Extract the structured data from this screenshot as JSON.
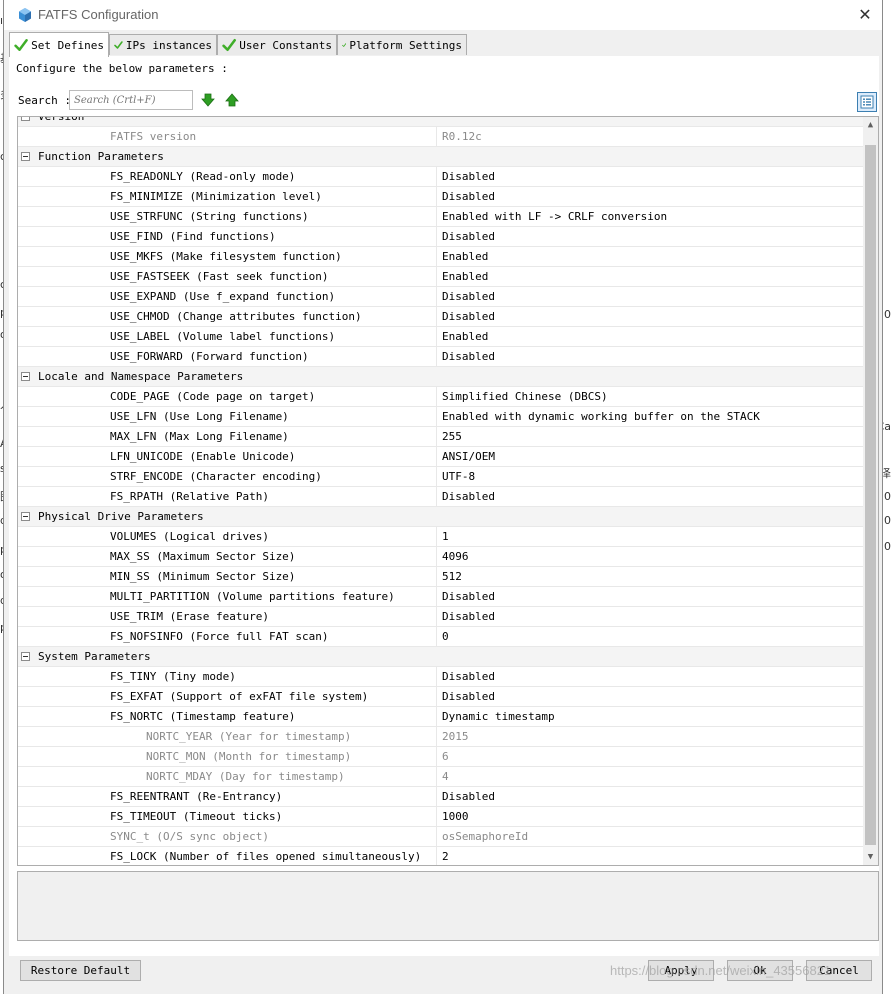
{
  "window": {
    "title": "FATFS Configuration",
    "close_glyph": "✕"
  },
  "background_fragments": [
    "ır",
    "多",
    "基",
    "co",
    "p",
    "or_",
    "人",
    "AT",
    "so",
    "图",
    "dı",
    "p",
    "or_",
    "dı",
    "p",
    "c",
    "0",
    "Ca",
    "0",
    "泽",
    "0",
    "0"
  ],
  "tabs": [
    {
      "label": "Set Defines",
      "active": true
    },
    {
      "label": "IPs instances",
      "active": false
    },
    {
      "label": "User Constants",
      "active": false
    },
    {
      "label": "Platform Settings",
      "active": false
    }
  ],
  "panel": {
    "configure_label": "Configure the below parameters :",
    "search_label": "Search :",
    "search_placeholder": "Search (Crtl+F)",
    "search_value": ""
  },
  "groups": [
    {
      "name": "Version",
      "params": [
        {
          "name": "FATFS version",
          "value": "R0.12c",
          "dim": true,
          "sub": false
        }
      ]
    },
    {
      "name": "Function Parameters",
      "params": [
        {
          "name": "FS_READONLY (Read-only mode)",
          "value": "Disabled",
          "dim": false,
          "sub": false
        },
        {
          "name": "FS_MINIMIZE (Minimization level)",
          "value": "Disabled",
          "dim": false,
          "sub": false
        },
        {
          "name": "USE_STRFUNC (String functions)",
          "value": "Enabled with LF -> CRLF conversion",
          "dim": false,
          "sub": false
        },
        {
          "name": "USE_FIND (Find functions)",
          "value": "Disabled",
          "dim": false,
          "sub": false
        },
        {
          "name": "USE_MKFS (Make filesystem function)",
          "value": "Enabled",
          "dim": false,
          "sub": false
        },
        {
          "name": "USE_FASTSEEK (Fast seek function)",
          "value": "Enabled",
          "dim": false,
          "sub": false
        },
        {
          "name": "USE_EXPAND (Use f_expand function)",
          "value": "Disabled",
          "dim": false,
          "sub": false
        },
        {
          "name": "USE_CHMOD (Change attributes function)",
          "value": "Disabled",
          "dim": false,
          "sub": false
        },
        {
          "name": "USE_LABEL (Volume label functions)",
          "value": "Enabled",
          "dim": false,
          "sub": false
        },
        {
          "name": "USE_FORWARD (Forward function)",
          "value": "Disabled",
          "dim": false,
          "sub": false
        }
      ]
    },
    {
      "name": "Locale and Namespace Parameters",
      "params": [
        {
          "name": "CODE_PAGE (Code page on target)",
          "value": "Simplified Chinese (DBCS)",
          "dim": false,
          "sub": false
        },
        {
          "name": "USE_LFN (Use Long Filename)",
          "value": "Enabled with dynamic working buffer on the STACK",
          "dim": false,
          "sub": false
        },
        {
          "name": "MAX_LFN (Max Long Filename)",
          "value": "255",
          "dim": false,
          "sub": false
        },
        {
          "name": "LFN_UNICODE (Enable Unicode)",
          "value": "ANSI/OEM",
          "dim": false,
          "sub": false
        },
        {
          "name": "STRF_ENCODE (Character encoding)",
          "value": "UTF-8",
          "dim": false,
          "sub": false
        },
        {
          "name": "FS_RPATH (Relative Path)",
          "value": "Disabled",
          "dim": false,
          "sub": false
        }
      ]
    },
    {
      "name": "Physical Drive Parameters",
      "params": [
        {
          "name": "VOLUMES (Logical drives)",
          "value": "1",
          "dim": false,
          "sub": false
        },
        {
          "name": "MAX_SS (Maximum Sector Size)",
          "value": "4096",
          "dim": false,
          "sub": false
        },
        {
          "name": "MIN_SS (Minimum Sector Size)",
          "value": "512",
          "dim": false,
          "sub": false
        },
        {
          "name": "MULTI_PARTITION (Volume partitions feature)",
          "value": "Disabled",
          "dim": false,
          "sub": false
        },
        {
          "name": "USE_TRIM (Erase feature)",
          "value": "Disabled",
          "dim": false,
          "sub": false
        },
        {
          "name": "FS_NOFSINFO (Force full FAT scan)",
          "value": "0",
          "dim": false,
          "sub": false
        }
      ]
    },
    {
      "name": "System Parameters",
      "params": [
        {
          "name": "FS_TINY (Tiny mode)",
          "value": "Disabled",
          "dim": false,
          "sub": false
        },
        {
          "name": "FS_EXFAT (Support of exFAT file system)",
          "value": "Disabled",
          "dim": false,
          "sub": false
        },
        {
          "name": "FS_NORTC (Timestamp feature)",
          "value": "Dynamic timestamp",
          "dim": false,
          "sub": false
        },
        {
          "name": "NORTC_YEAR (Year for timestamp)",
          "value": "2015",
          "dim": true,
          "sub": true
        },
        {
          "name": "NORTC_MON (Month for timestamp)",
          "value": "6",
          "dim": true,
          "sub": true
        },
        {
          "name": "NORTC_MDAY (Day for timestamp)",
          "value": "4",
          "dim": true,
          "sub": true
        },
        {
          "name": "FS_REENTRANT (Re-Entrancy)",
          "value": "Disabled",
          "dim": false,
          "sub": false
        },
        {
          "name": "FS_TIMEOUT (Timeout ticks)",
          "value": "1000",
          "dim": false,
          "sub": false
        },
        {
          "name": "SYNC_t (O/S sync object)",
          "value": "osSemaphoreId",
          "dim": true,
          "sub": false
        },
        {
          "name": "FS_LOCK (Number of files opened simultaneously)",
          "value": "2",
          "dim": false,
          "sub": false
        }
      ]
    }
  ],
  "footer": {
    "restore_label": "Restore Default",
    "apply_label": "Apply",
    "ok_label": "Ok",
    "cancel_label": "Cancel",
    "watermark": "https://blog.csdn.net/weixin_43556821"
  },
  "colors": {
    "check_green": "#3fae29",
    "arrow_green": "#2e9e23",
    "title_icon_blue": "#3a8fd6",
    "selected_button_blue": "#3c7fb1"
  }
}
